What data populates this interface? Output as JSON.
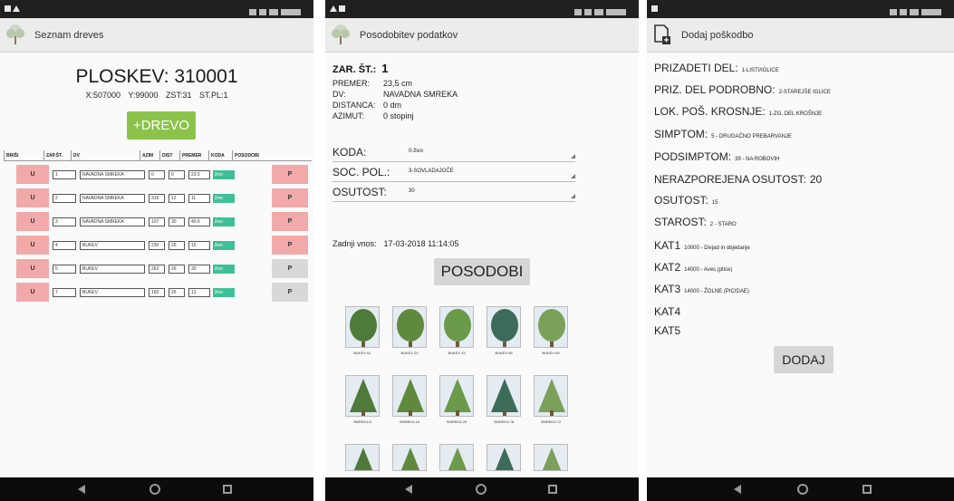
{
  "screen1": {
    "title": "Seznam dreves",
    "plot_title": "PLOSKEV: 310001",
    "plot_sub": "X:507000 Y:99000 ZST:31 ST.PL:1",
    "add_button": "+DREVO",
    "table_headers": [
      "BRIŠI",
      "ZAP.ŠT.",
      "DV",
      "AZIM",
      "DIST",
      "PREMER",
      "KODA",
      "POSODOBI"
    ],
    "rows": [
      {
        "u": "U",
        "zap": "1",
        "dv": "NAVADNA SMREKA",
        "azim": "0",
        "dist": "0",
        "premer": "23.5",
        "koda": "živo",
        "p": "P",
        "p_style": "red"
      },
      {
        "u": "U",
        "zap": "2",
        "dv": "NAVADNA SMREKA",
        "azim": "316",
        "dist": "12",
        "premer": "11",
        "koda": "živo",
        "p": "P",
        "p_style": "red"
      },
      {
        "u": "U",
        "zap": "3",
        "dv": "NAVADNA SMREKA",
        "azim": "107",
        "dist": "30",
        "premer": "40.6",
        "koda": "živo",
        "p": "P",
        "p_style": "red"
      },
      {
        "u": "U",
        "zap": "4",
        "dv": "BUKEV",
        "azim": "230",
        "dist": "26",
        "premer": "16",
        "koda": "živo",
        "p": "P",
        "p_style": "red"
      },
      {
        "u": "U",
        "zap": "5",
        "dv": "BUKEV",
        "azim": "262",
        "dist": "26",
        "premer": "30",
        "koda": "živo",
        "p": "P",
        "p_style": "grey"
      },
      {
        "u": "U",
        "zap": "7",
        "dv": "BUKEV",
        "azim": "160",
        "dist": "26",
        "premer": "13",
        "koda": "živo",
        "p": "P",
        "p_style": "grey"
      }
    ]
  },
  "screen2": {
    "title": "Posodobitev podatkov",
    "zar_label": "ZAR. ŠT.:",
    "zar_value": "1",
    "premer_label": "PREMER:",
    "premer_value": "23,5 cm",
    "dv_label": "DV:",
    "dv_value": "NAVADNA SMREKA",
    "distanca_label": "DISTANCA:",
    "distanca_value": "0 dm",
    "azimut_label": "AZIMUT:",
    "azimut_value": "0 stopinj",
    "koda_label": "KODA:",
    "koda_value": "0-živo",
    "soc_label": "SOC. POL.:",
    "soc_value": "3-SOVLADAJOČE",
    "osutost_label": "OSUTOST:",
    "osutost_value": "30",
    "last_entry_label": "Zadnji vnos:",
    "last_entry_value": "17-03-2018 11:14:05",
    "update_button": "POSODOBI",
    "thumbs": [
      "BUKEV 61",
      "BUKEV 20",
      "BUKEV 33",
      "BUKEV 68",
      "BUKEV 69",
      "SMREKA 5",
      "SMREKA 16",
      "SMREKA 25",
      "SMREKA 78",
      "SMREKA 72",
      "",
      "",
      "",
      "",
      ""
    ]
  },
  "screen3": {
    "title": "Dodaj poškodbo",
    "fields": [
      {
        "label": "PRIZADETI DEL:",
        "value": "1-LISTI/IGLICE",
        "big": false
      },
      {
        "label": "PRIZ. DEL PODROBNO:",
        "value": "2-STAREJŠE IGLICE",
        "big": false
      },
      {
        "label": "LOK. POŠ. KROSNJE:",
        "value": "1-ZG. DEL KROŠNJE",
        "big": false
      },
      {
        "label": "SIMPTOM:",
        "value": "5 - DRUGAČNO PREBARVANJE",
        "big": false
      },
      {
        "label": "PODSIMPTOM:",
        "value": "39 - NA ROBOVIH",
        "big": false
      },
      {
        "label": "NERAZPOREJENA OSUTOST:",
        "value": "20",
        "big": true
      },
      {
        "label": "OSUTOST:",
        "value": "15",
        "big": false
      },
      {
        "label": "STAROST:",
        "value": "2 - STARO",
        "big": false
      },
      {
        "label": "KAT1",
        "value": "10000 - Divjad in objedanje",
        "big": false
      },
      {
        "label": "KAT2",
        "value": "14000 - Aves (ptice)",
        "big": false
      },
      {
        "label": "KAT3",
        "value": "14000 - ŽOLNE (PICIDAE)",
        "big": false
      },
      {
        "label": "KAT4",
        "value": "",
        "big": false
      },
      {
        "label": "KAT5",
        "value": "",
        "big": false
      }
    ],
    "add_button": "DODAJ"
  },
  "colors": {
    "green_button": "#8bc34a",
    "row_button_red": "#f1a9a9",
    "row_button_grey": "#d8d8d8",
    "koda_teal": "#3fbf97",
    "grey_button": "#d6d6d6"
  }
}
